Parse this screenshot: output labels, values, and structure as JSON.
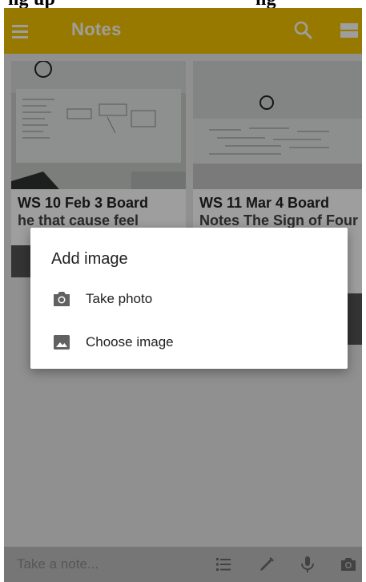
{
  "caption": {
    "left_text": "ng up",
    "right_text": "ng"
  },
  "app_bar": {
    "title": "Notes",
    "icons": [
      "menu-icon",
      "search-icon",
      "view-toggle-icon"
    ]
  },
  "notes": [
    {
      "title": "WS 10 Feb 3 Board",
      "subtitle": "he that cause feel",
      "image": "whiteboard-photo"
    },
    {
      "title": "WS 11 Mar 4 Board",
      "subtitle": "Notes The Sign of Four",
      "image": "whiteboard-photo"
    }
  ],
  "dialog": {
    "title": "Add image",
    "options": [
      {
        "label": "Take photo",
        "icon": "camera-icon"
      },
      {
        "label": "Choose image",
        "icon": "image-icon"
      }
    ]
  },
  "bottom_bar": {
    "placeholder": "Take a note...",
    "icons": [
      "list-icon",
      "pen-icon",
      "mic-icon",
      "camera-icon"
    ]
  },
  "colors": {
    "app_bar": "#f6c400",
    "scrim": "rgba(0,0,0,0.38)",
    "dialog_bg": "#ffffff"
  }
}
